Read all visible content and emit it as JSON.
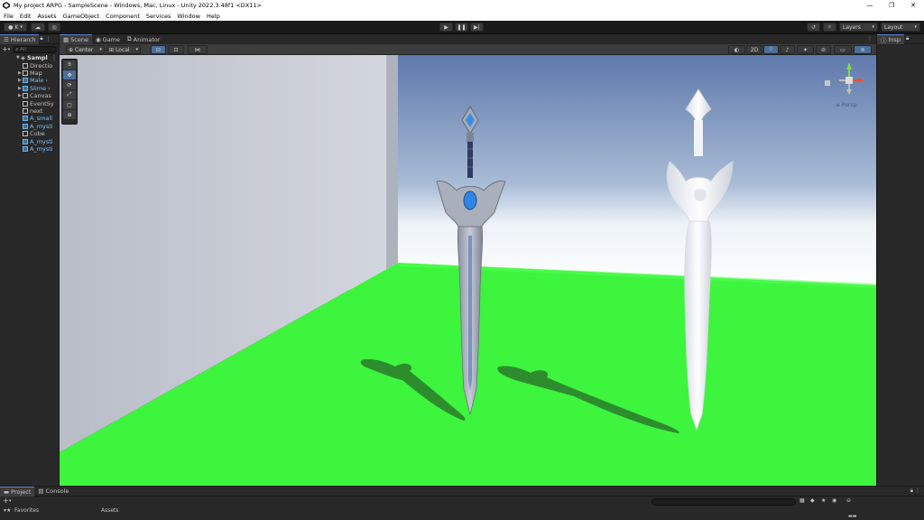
{
  "window": {
    "title": "My project ARPG - SampleScene - Windows, Mac, Linux - Unity 2022.3.48f1 <DX11>",
    "minimize": "—",
    "maximize": "❐",
    "close": "✕"
  },
  "menu": [
    "File",
    "Edit",
    "Assets",
    "GameObject",
    "Component",
    "Services",
    "Window",
    "Help"
  ],
  "toolbar": {
    "account": "K",
    "layers": "Layers",
    "layout": "Layout"
  },
  "hierarchy": {
    "tab": "Hierarch",
    "search_placeholder": "All",
    "scene": "Sampl",
    "items": [
      {
        "label": "Directio",
        "prefab": false,
        "arrow": ""
      },
      {
        "label": "Map",
        "prefab": false,
        "arrow": "▶"
      },
      {
        "label": "Male",
        "prefab": true,
        "arrow": "▶"
      },
      {
        "label": "Slime",
        "prefab": true,
        "arrow": "▶"
      },
      {
        "label": "Canvas",
        "prefab": false,
        "arrow": "▶"
      },
      {
        "label": "EventSy",
        "prefab": false,
        "arrow": ""
      },
      {
        "label": "next",
        "prefab": false,
        "arrow": ""
      },
      {
        "label": "A_small",
        "prefab": true,
        "arrow": ""
      },
      {
        "label": "A_mysti",
        "prefab": true,
        "arrow": ""
      },
      {
        "label": "Cube",
        "prefab": false,
        "arrow": ""
      },
      {
        "label": "A_mysti",
        "prefab": true,
        "arrow": ""
      },
      {
        "label": "A_mysti",
        "prefab": true,
        "arrow": ""
      }
    ]
  },
  "scene": {
    "tabs": [
      "Scene",
      "Game",
      "Animator"
    ],
    "pivot": "Center",
    "space": "Local",
    "mode2d": "2D",
    "persp": "≡ Persp"
  },
  "inspector": {
    "tab": "Insp"
  },
  "project": {
    "tabs": [
      "Project",
      "Console"
    ],
    "favorites": "Favorites",
    "assets": "Assets"
  },
  "colors": {
    "ground": "#3df53d",
    "sky_top": "#5e79ab",
    "wall": "#c9ccd6",
    "accent": "#5a8ad4"
  }
}
